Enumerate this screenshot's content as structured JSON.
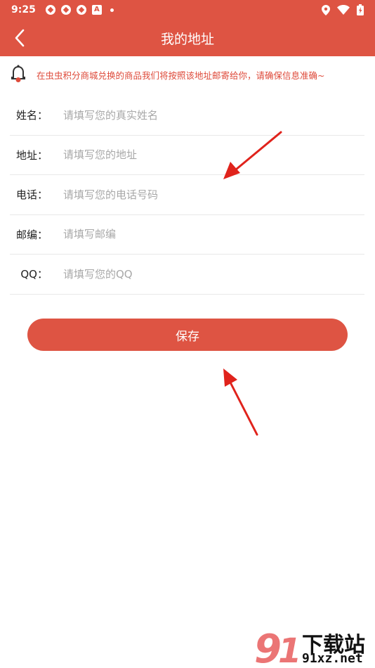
{
  "status_bar": {
    "time": "9:25",
    "notification_icon_label": "A"
  },
  "app_bar": {
    "title": "我的地址"
  },
  "notice": {
    "text": "在虫虫积分商城兑换的商品我们将按照该地址邮寄给你，请确保信息准确~"
  },
  "form": {
    "fields": [
      {
        "label": "姓名：",
        "placeholder": "请填写您的真实姓名",
        "value": ""
      },
      {
        "label": "地址：",
        "placeholder": "请填写您的地址",
        "value": ""
      },
      {
        "label": "电话：",
        "placeholder": "请填写您的电话号码",
        "value": ""
      },
      {
        "label": "邮编：",
        "placeholder": "请填写邮编",
        "value": ""
      },
      {
        "label": "QQ：",
        "placeholder": "请填写您的QQ",
        "value": ""
      }
    ]
  },
  "save_button": {
    "label": "保存"
  },
  "watermark": {
    "brand": "下载站",
    "domain": "91xz.net"
  },
  "colors": {
    "primary": "#de5443",
    "notice_text": "#de4a3a",
    "placeholder": "#a8a8a8",
    "divider": "#e8e8e8"
  }
}
